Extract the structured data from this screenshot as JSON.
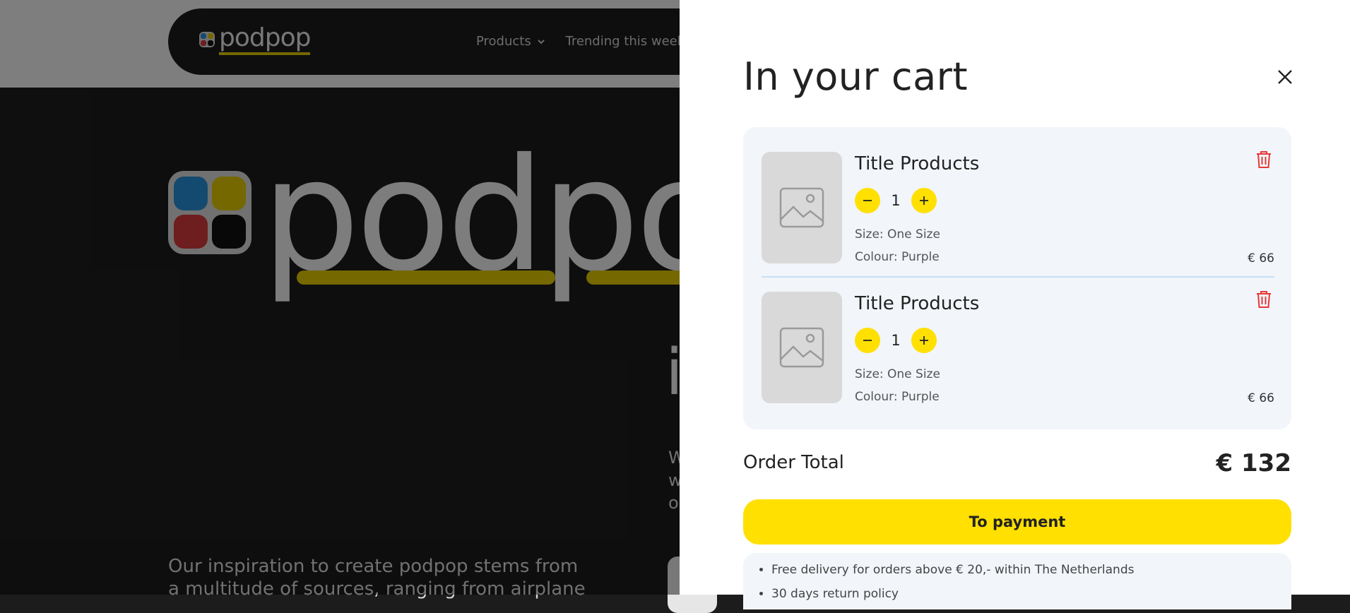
{
  "brand": {
    "wordmark": "podpop",
    "colors": {
      "blue": "#2a8fd6",
      "yellow": "#e0c800",
      "red": "#d33a3a",
      "black": "#111111"
    }
  },
  "nav": {
    "links": [
      "Products",
      "Trending this week"
    ],
    "dropdown_icon": "chevron-down-icon"
  },
  "hero": {
    "wordmark": "podpo",
    "partial_char": "i",
    "side_text": [
      "W",
      "w",
      "o"
    ],
    "inspiration": "Our inspiration to create podpop stems from a multitude of sources, ranging from airplane"
  },
  "cart": {
    "title": "In your cart",
    "close_icon": "close-icon",
    "items": [
      {
        "name": "Title Products",
        "quantity": "1",
        "size": "Size: One Size",
        "colour": "Colour: Purple",
        "price": "€ 66"
      },
      {
        "name": "Title Products",
        "quantity": "1",
        "size": "Size: One Size",
        "colour": "Colour: Purple",
        "price": "€ 66"
      }
    ],
    "order_total_label": "Order Total",
    "order_total_value": "€ 132",
    "payment_button": "To payment",
    "info": [
      "Free delivery for orders above € 20,- within The Netherlands",
      "30 days return policy"
    ],
    "accent": "#ffe000",
    "panel_bg": "#f2f5fa",
    "delete_color": "#e53935"
  }
}
